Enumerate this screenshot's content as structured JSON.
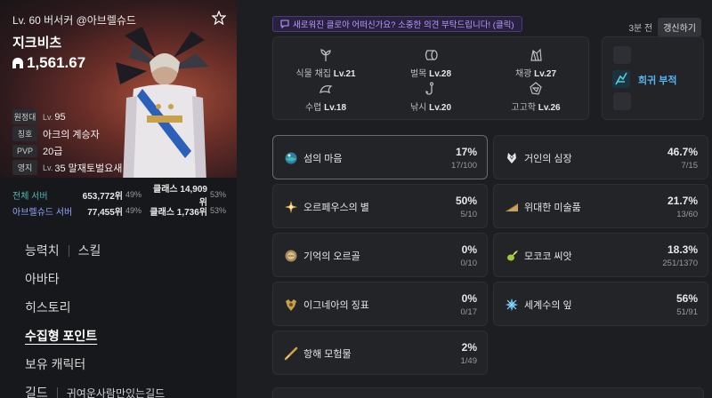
{
  "profile": {
    "level_line": "Lv. 60 버서커 @아브렐슈드",
    "name": "지크비츠",
    "power": "1,561.67",
    "badges": [
      {
        "tag": "원정대",
        "prefix": "Lv.",
        "value": "95"
      },
      {
        "tag": "칭호",
        "prefix": "",
        "value": "아크의 계승자"
      },
      {
        "tag": "PVP",
        "prefix": "",
        "value": "20급"
      },
      {
        "tag": "영지",
        "prefix": "Lv.",
        "value": "35 말재토벌요새"
      }
    ]
  },
  "rankings": [
    {
      "label": "전체 서버",
      "rank": "653,772위",
      "pct": "49%",
      "class_rank": "클래스 14,909위",
      "class_pct": "53%"
    },
    {
      "label": "아브렐슈드 서버",
      "rank": "77,455위",
      "pct": "49%",
      "class_rank": "클래스 1,736위",
      "class_pct": "53%"
    }
  ],
  "nav": {
    "stats": "능력치",
    "skills": "스킬",
    "avatar": "아바타",
    "history": "히스토리",
    "collectibles": "수집형 포인트",
    "characters": "보유 캐릭터",
    "guild": "길드",
    "guild_name": "귀여운사람만있는길드"
  },
  "notice": "새로워진 클로아 어떠신가요? 소중한 의견 부탁드립니다! (클릭)",
  "updated": {
    "time": "3분 전",
    "refresh": "갱신하기"
  },
  "life_skills": [
    {
      "name": "식물 채집",
      "level": "Lv.21",
      "icon": "sprout-icon"
    },
    {
      "name": "벌목",
      "level": "Lv.28",
      "icon": "log-icon"
    },
    {
      "name": "채광",
      "level": "Lv.27",
      "icon": "ore-icon"
    },
    {
      "name": "수렵",
      "level": "Lv.18",
      "icon": "hunt-icon"
    },
    {
      "name": "낚시",
      "level": "Lv.20",
      "icon": "hook-icon"
    },
    {
      "name": "고고학",
      "level": "Lv.26",
      "icon": "relic-icon"
    }
  ],
  "rare": {
    "label": "희귀 부적"
  },
  "collectibles": [
    {
      "name": "섬의 마음",
      "pct": "17%",
      "count": "17/100",
      "icon": "island-heart-icon",
      "color": "#3fb8a8"
    },
    {
      "name": "거인의 심장",
      "pct": "46.7%",
      "count": "7/15",
      "icon": "giant-heart-icon",
      "color": "#e8e8e8"
    },
    {
      "name": "오르페우스의 별",
      "pct": "50%",
      "count": "5/10",
      "icon": "orpheus-star-icon",
      "color": "#e8b14a"
    },
    {
      "name": "위대한 미술품",
      "pct": "21.7%",
      "count": "13/60",
      "icon": "art-icon",
      "color": "#c8a060"
    },
    {
      "name": "기억의 오르골",
      "pct": "0%",
      "count": "0/10",
      "icon": "music-box-icon",
      "color": "#c9b07a"
    },
    {
      "name": "모코코 씨앗",
      "pct": "18.3%",
      "count": "251/1370",
      "icon": "mokoko-seed-icon",
      "color": "#9ccc3a"
    },
    {
      "name": "이그네아의 징표",
      "pct": "0%",
      "count": "0/17",
      "icon": "ignea-token-icon",
      "color": "#c9a04a"
    },
    {
      "name": "세계수의 잎",
      "pct": "56%",
      "count": "51/91",
      "icon": "world-tree-leaf-icon",
      "color": "#5cb7e8"
    },
    {
      "name": "항해 모험물",
      "pct": "2%",
      "count": "1/49",
      "icon": "voyage-icon",
      "color": "#d4a24a"
    }
  ]
}
